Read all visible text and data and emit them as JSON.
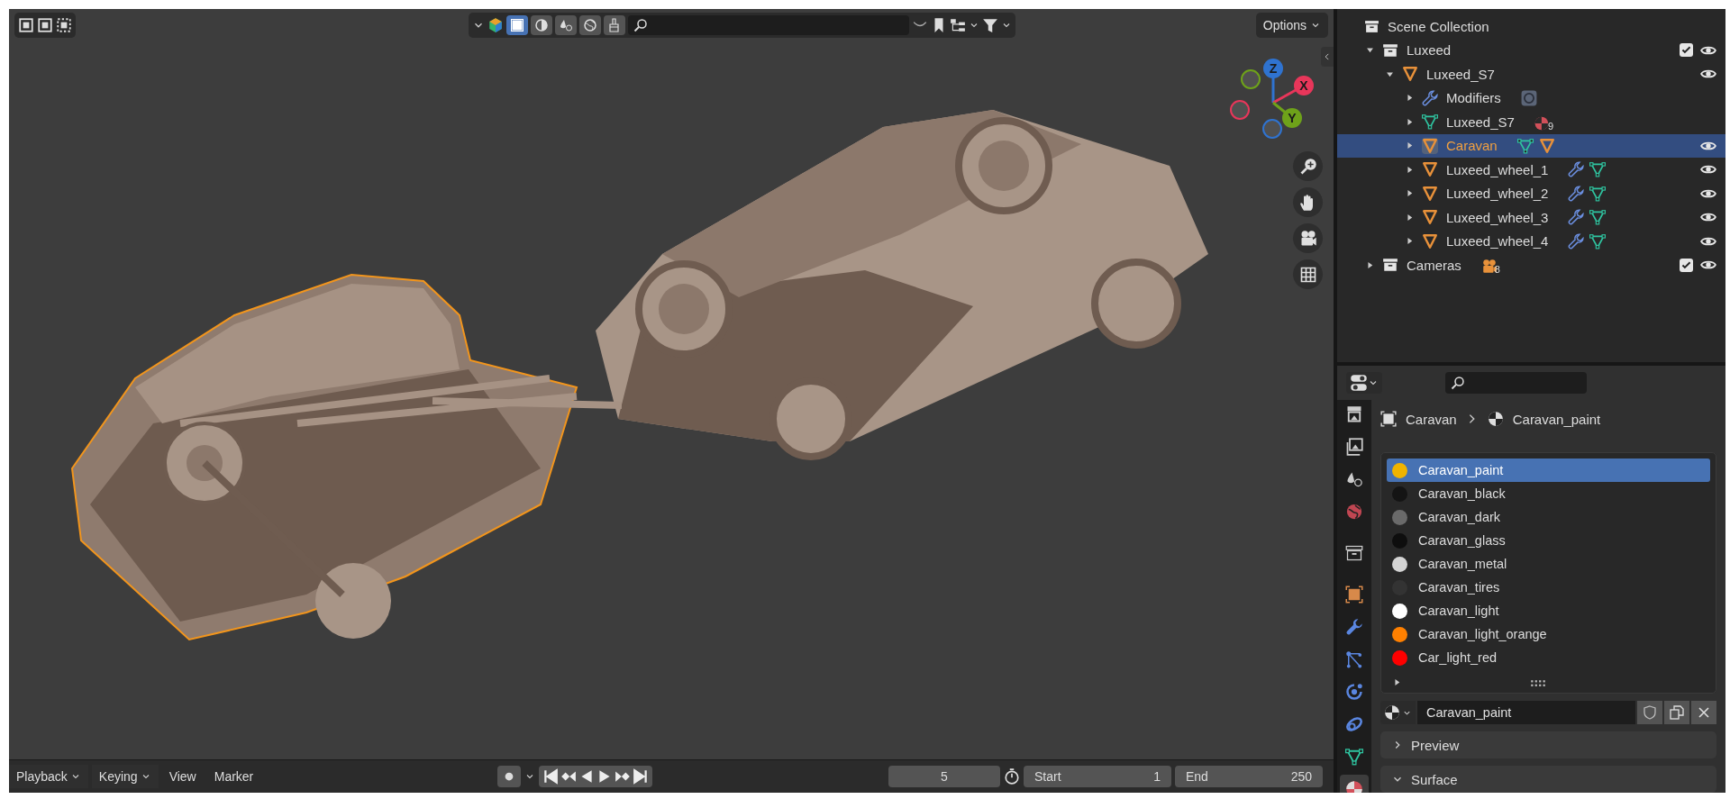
{
  "viewport": {
    "header": {
      "shading": [
        {
          "kind": "box",
          "selected": true
        },
        {
          "kind": "solid",
          "selected": false
        },
        {
          "kind": "drops",
          "selected": false
        },
        {
          "kind": "globe",
          "selected": false
        },
        {
          "kind": "brush",
          "selected": false
        }
      ],
      "options_label": "Options"
    },
    "model": {
      "trailer_selected": true
    },
    "gizmo": {
      "axes": [
        {
          "label": "Z",
          "color": "#2f73d0"
        },
        {
          "label": "X",
          "color": "#e8365a"
        },
        {
          "label": "Y",
          "color": "#6ea21a"
        }
      ]
    }
  },
  "timeline": {
    "menus": [
      {
        "label": "Playback",
        "dropdown": true
      },
      {
        "label": "Keying",
        "dropdown": true
      },
      {
        "label": "View",
        "dropdown": false
      },
      {
        "label": "Marker",
        "dropdown": false
      }
    ],
    "current_frame": "5",
    "start_label": "Start",
    "start": "1",
    "end_label": "End",
    "end": "250"
  },
  "outliner": {
    "root": "Scene Collection",
    "tree": [
      {
        "label": "Luxeed",
        "kind": "collection",
        "expanded": true,
        "selected": false,
        "checked": true,
        "visible": true,
        "children": [
          {
            "label": "Luxeed_S7",
            "kind": "object",
            "expanded": true,
            "selected": false,
            "visible": true,
            "children": [
              {
                "label": "Modifiers",
                "kind": "modifier",
                "expanded": false,
                "selected": false,
                "extras": [
                  {
                    "kind": "modifier-box"
                  }
                ]
              },
              {
                "label": "Luxeed_S7",
                "kind": "mesh",
                "expanded": false,
                "selected": false,
                "extras": [
                  {
                    "kind": "material",
                    "count": "9"
                  }
                ]
              },
              {
                "label": "Caravan",
                "kind": "object",
                "expanded": false,
                "selected": true,
                "visible": true,
                "extras": [
                  {
                    "kind": "mesh"
                  },
                  {
                    "kind": "object"
                  }
                ]
              },
              {
                "label": "Luxeed_wheel_1",
                "kind": "object",
                "expanded": false,
                "selected": false,
                "visible": true,
                "extras": [
                  {
                    "kind": "wrench"
                  },
                  {
                    "kind": "mesh"
                  }
                ]
              },
              {
                "label": "Luxeed_wheel_2",
                "kind": "object",
                "expanded": false,
                "selected": false,
                "visible": true,
                "extras": [
                  {
                    "kind": "wrench"
                  },
                  {
                    "kind": "mesh"
                  }
                ]
              },
              {
                "label": "Luxeed_wheel_3",
                "kind": "object",
                "expanded": false,
                "selected": false,
                "visible": true,
                "extras": [
                  {
                    "kind": "wrench"
                  },
                  {
                    "kind": "mesh"
                  }
                ]
              },
              {
                "label": "Luxeed_wheel_4",
                "kind": "object",
                "expanded": false,
                "selected": false,
                "visible": true,
                "extras": [
                  {
                    "kind": "wrench"
                  },
                  {
                    "kind": "mesh"
                  }
                ]
              }
            ]
          }
        ]
      },
      {
        "label": "Cameras",
        "kind": "collection",
        "expanded": false,
        "selected": false,
        "checked": true,
        "visible": true,
        "extras": [
          {
            "kind": "camera",
            "count": "8"
          }
        ]
      }
    ]
  },
  "properties": {
    "tabs": [
      {
        "kind": "render",
        "selected": false
      },
      {
        "kind": "output",
        "selected": false
      },
      {
        "kind": "scene",
        "selected": false
      },
      {
        "kind": "world",
        "selected": false
      },
      {
        "kind": "collection",
        "selected": false
      },
      {
        "kind": "object",
        "selected": false
      },
      {
        "kind": "modifiers",
        "selected": false
      },
      {
        "kind": "particles",
        "selected": false
      },
      {
        "kind": "physics",
        "selected": false
      },
      {
        "kind": "constraints",
        "selected": false
      },
      {
        "kind": "data",
        "selected": false
      },
      {
        "kind": "material",
        "selected": true
      }
    ],
    "breadcrumb": [
      "Caravan",
      "Caravan_paint"
    ],
    "material_slots": [
      {
        "name": "Caravan_paint",
        "color": "#f0b400",
        "selected": true
      },
      {
        "name": "Caravan_black",
        "color": "#141414",
        "selected": false
      },
      {
        "name": "Caravan_dark",
        "color": "#6a6a6a",
        "selected": false
      },
      {
        "name": "Caravan_glass",
        "color": "#0e0e0e",
        "selected": false
      },
      {
        "name": "Caravan_metal",
        "color": "#d4d4d4",
        "selected": false
      },
      {
        "name": "Caravan_tires",
        "color": "#333333",
        "selected": false
      },
      {
        "name": "Caravan_light",
        "color": "#ffffff",
        "selected": false
      },
      {
        "name": "Caravan_light_orange",
        "color": "#ff8000",
        "selected": false
      },
      {
        "name": "Car_light_red",
        "color": "#ff0000",
        "selected": false
      }
    ],
    "material_name": "Caravan_paint",
    "panels": [
      {
        "label": "Preview",
        "expanded": false
      },
      {
        "label": "Surface",
        "expanded": true
      }
    ]
  }
}
